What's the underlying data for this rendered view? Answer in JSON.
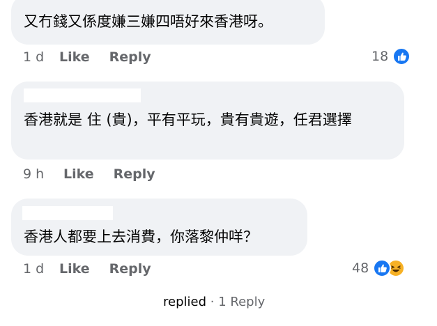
{
  "comments": [
    {
      "text": "又冇錢又係度嫌三嫌四唔好來香港呀。",
      "time": "1 d",
      "like_label": "Like",
      "reply_label": "Reply",
      "reaction_count": "18",
      "reactions": [
        "like-icon"
      ]
    },
    {
      "text": "香港就是 住 (貴)，平有平玩，貴有貴遊，任君選擇",
      "time": "9 h",
      "like_label": "Like",
      "reply_label": "Reply"
    },
    {
      "text": "香港人都要上去消費，你落黎仲咩？",
      "time": "1 d",
      "like_label": "Like",
      "reply_label": "Reply",
      "reaction_count": "48",
      "reactions": [
        "like-icon",
        "haha-icon"
      ]
    }
  ],
  "replies": {
    "prefix": "replied",
    "separator": "·",
    "count": "1 Reply"
  },
  "colors": {
    "bubble": "#f0f2f5",
    "secondary_text": "#65676b",
    "like_blue": "#1877f2",
    "haha_yellow": "#f7b125"
  }
}
